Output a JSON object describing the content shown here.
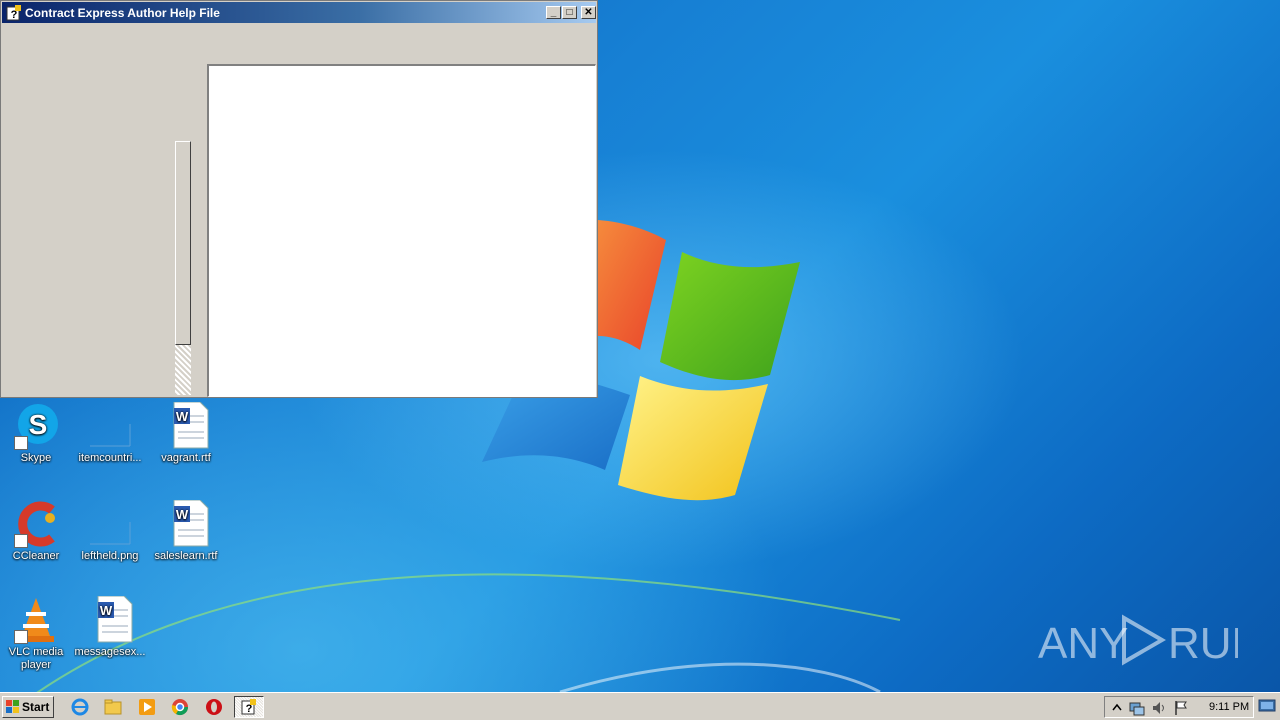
{
  "window": {
    "title": "Contract Express Author Help File",
    "minimize_glyph": "_",
    "maximize_glyph": "□",
    "close_glyph": "✕"
  },
  "desktop": {
    "icons": [
      {
        "label": "Skype",
        "icon": "skype-icon"
      },
      {
        "label": "itemcountri...",
        "icon": "blank-file-icon"
      },
      {
        "label": "vagrant.rtf",
        "icon": "word-document-icon"
      },
      {
        "label": "CCleaner",
        "icon": "ccleaner-icon"
      },
      {
        "label": "leftheld.png",
        "icon": "blank-file-icon"
      },
      {
        "label": "saleslearn.rtf",
        "icon": "word-document-icon"
      },
      {
        "label": "VLC media player",
        "icon": "vlc-icon"
      },
      {
        "label": "messagesex...",
        "icon": "word-document-icon"
      }
    ],
    "watermark": "ANY RUN"
  },
  "taskbar": {
    "start_label": "Start",
    "quick_launch": [
      "internet-explorer-icon",
      "file-explorer-icon",
      "media-player-icon",
      "chrome-icon",
      "opera-icon"
    ],
    "active_task": "help-file-icon",
    "tray_icons": [
      "show-hidden-icons-arrow",
      "network-icon",
      "volume-icon",
      "action-center-flag-icon"
    ],
    "clock": "9:11 PM"
  }
}
